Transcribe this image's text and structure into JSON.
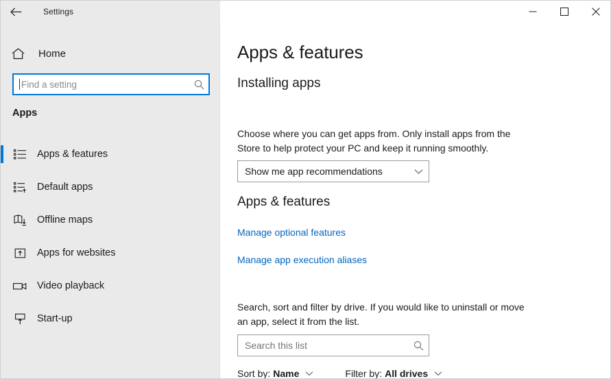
{
  "titlebar": {
    "back_icon": "back-arrow-icon",
    "title": "Settings",
    "minimize_label": "minimize-icon",
    "maximize_label": "maximize-icon",
    "close_label": "close-icon"
  },
  "sidebar": {
    "home_label": "Home",
    "home_icon": "home-icon",
    "search": {
      "placeholder": "Find a setting",
      "icon": "search-icon",
      "value": ""
    },
    "section_label": "Apps",
    "items": [
      {
        "label": "Apps & features",
        "icon": "list-bullets-icon",
        "selected": true
      },
      {
        "label": "Default apps",
        "icon": "list-arrow-icon",
        "selected": false
      },
      {
        "label": "Offline maps",
        "icon": "map-download-icon",
        "selected": false
      },
      {
        "label": "Apps for websites",
        "icon": "app-window-arrow-icon",
        "selected": false
      },
      {
        "label": "Video playback",
        "icon": "video-camera-icon",
        "selected": false
      },
      {
        "label": "Start-up",
        "icon": "startup-monitor-icon",
        "selected": false
      }
    ]
  },
  "main": {
    "page_title": "Apps & features",
    "installing": {
      "heading": "Installing apps",
      "description": "Choose where you can get apps from. Only install apps from the Store to help protect your PC and keep it running smoothly.",
      "dropdown_value": "Show me app recommendations",
      "dropdown_icon": "chevron-down-icon"
    },
    "apps_features": {
      "heading": "Apps & features",
      "links": [
        {
          "label": "Manage optional features"
        },
        {
          "label": "Manage app execution aliases"
        }
      ],
      "description": "Search, sort and filter by drive. If you would like to uninstall or move an app, select it from the list.",
      "search": {
        "placeholder": "Search this list",
        "icon": "search-icon",
        "value": ""
      },
      "sort": {
        "key": "Sort by:",
        "value": "Name",
        "icon": "chevron-down-icon"
      },
      "filter": {
        "key": "Filter by:",
        "value": "All drives",
        "icon": "chevron-down-icon"
      }
    }
  },
  "colors": {
    "accent": "#0078d7",
    "link": "#0067c0",
    "sidebar_bg": "#eaeaea",
    "content_bg": "#ffffff",
    "text": "#1a1a1a"
  }
}
